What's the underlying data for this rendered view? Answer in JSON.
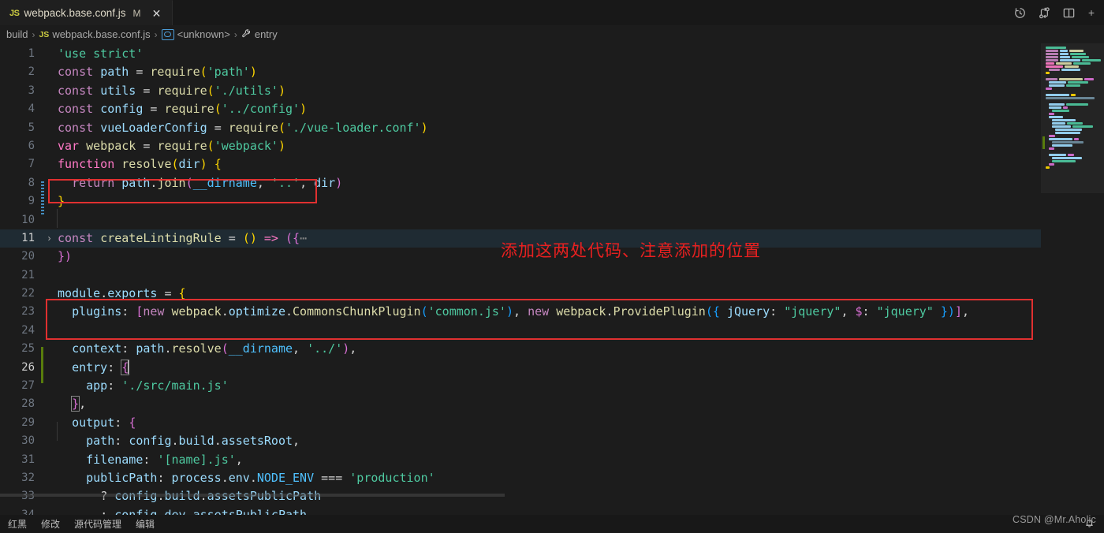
{
  "window": {
    "tab": {
      "lang_badge": "JS",
      "title": "webpack.base.conf.js",
      "dirty_marker": "M",
      "close_glyph": "✕"
    },
    "actions": [
      {
        "name": "timeline-history-icon",
        "tooltip": "Timeline"
      },
      {
        "name": "compare-changes-icon",
        "tooltip": "Open Changes"
      },
      {
        "name": "split-editor-icon",
        "tooltip": "Split Editor"
      },
      {
        "name": "more-actions-icon",
        "tooltip": "More Actions"
      }
    ]
  },
  "breadcrumb": [
    {
      "label": "build",
      "icon": "",
      "sep": "›"
    },
    {
      "label": "webpack.base.conf.js",
      "icon": "JS",
      "sep": "›"
    },
    {
      "label": "<unknown>",
      "icon": "module-icon",
      "sep": "›"
    },
    {
      "label": "entry",
      "icon": "wrench-icon",
      "sep": ""
    }
  ],
  "annotation": {
    "note_text": "添加这两处代码、注意添加的位置",
    "note_color": "#e82020",
    "box_color": "#e03030",
    "boxes": [
      {
        "name": "redbox-line6",
        "line": 6
      },
      {
        "name": "redbox-line23",
        "line": 23
      }
    ]
  },
  "editor": {
    "language": "JavaScript",
    "theme_bg": "#1c1c1c",
    "highlighted_line": 11,
    "cursor_line": 26,
    "git_added_lines": [
      23,
      24
    ],
    "folded_lines": [
      11
    ],
    "lines": [
      {
        "n": "1",
        "text": "'use strict'"
      },
      {
        "n": "2",
        "text": "const path = require('path')"
      },
      {
        "n": "3",
        "text": "const utils = require('./utils')"
      },
      {
        "n": "4",
        "text": "const config = require('../config')"
      },
      {
        "n": "5",
        "text": "const vueLoaderConfig = require('./vue-loader.conf')"
      },
      {
        "n": "6",
        "text": "var webpack = require('webpack')"
      },
      {
        "n": "7",
        "text": "function resolve(dir) {"
      },
      {
        "n": "8",
        "text": "  return path.join(__dirname, '..', dir)"
      },
      {
        "n": "9",
        "text": "}"
      },
      {
        "n": "10",
        "text": ""
      },
      {
        "n": "11",
        "text": "const createLintingRule = () => ({⋯"
      },
      {
        "n": "20",
        "text": "})"
      },
      {
        "n": "21",
        "text": ""
      },
      {
        "n": "22",
        "text": "module.exports = {"
      },
      {
        "n": "23",
        "text": "  plugins: [new webpack.optimize.CommonsChunkPlugin('common.js'), new webpack.ProvidePlugin({ jQuery: \"jquery\", $: \"jquery\" })],"
      },
      {
        "n": "24",
        "text": ""
      },
      {
        "n": "25",
        "text": "  context: path.resolve(__dirname, '../'),"
      },
      {
        "n": "26",
        "text": "  entry: {"
      },
      {
        "n": "27",
        "text": "    app: './src/main.js'"
      },
      {
        "n": "28",
        "text": "  },"
      },
      {
        "n": "29",
        "text": "  output: {"
      },
      {
        "n": "30",
        "text": "    path: config.build.assetsRoot,"
      },
      {
        "n": "31",
        "text": "    filename: '[name].js',"
      },
      {
        "n": "32",
        "text": "    publicPath: process.env.NODE_ENV === 'production'"
      },
      {
        "n": "33",
        "text": "      ? config.build.assetsPublicPath"
      },
      {
        "n": "34",
        "text": "      : config.dev.assetsPublicPath"
      }
    ]
  },
  "statusbar": {
    "left_items": [
      "红黑",
      "修改",
      "源代码管理",
      "编辑"
    ],
    "right_items": []
  },
  "watermark": "CSDN @Mr.Aholic",
  "colors": {
    "editor_bg": "#1c1c1c",
    "tab_active_bg": "#1f1f1f",
    "tabbar_bg": "#181818",
    "line_number": "#6e7681",
    "highlight_line_bg": "#1f2b33",
    "git_added": "#587c0c",
    "keyword": "#c586c0",
    "string": "#4ec9a0",
    "function": "#dcdcaa",
    "variable": "#9cdcfe",
    "brace1": "#ffd700",
    "brace2": "#da70d6",
    "brace3": "#179fff"
  }
}
